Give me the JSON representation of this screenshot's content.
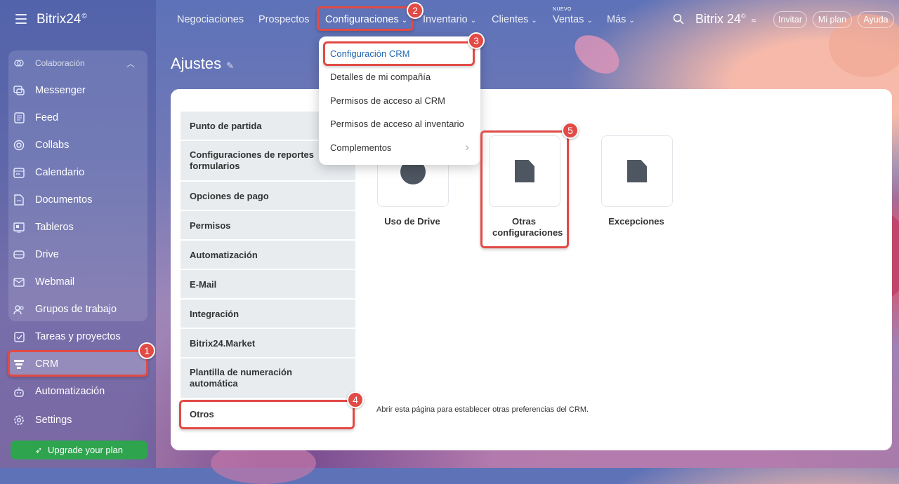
{
  "brand": {
    "name": "Bitrix24",
    "mark": "©"
  },
  "sidebar": {
    "group_label": "Colaboración",
    "items": [
      {
        "label": "Messenger"
      },
      {
        "label": "Feed"
      },
      {
        "label": "Collabs"
      },
      {
        "label": "Calendario"
      },
      {
        "label": "Documentos"
      },
      {
        "label": "Tableros"
      },
      {
        "label": "Drive"
      },
      {
        "label": "Webmail"
      },
      {
        "label": "Grupos de trabajo"
      }
    ],
    "extra": [
      {
        "label": "Tareas y proyectos"
      },
      {
        "label": "CRM"
      },
      {
        "label": "Automatización"
      },
      {
        "label": "Settings"
      }
    ],
    "upgrade_label": "Upgrade your plan"
  },
  "topnav": {
    "items": [
      {
        "label": "Negociaciones"
      },
      {
        "label": "Prospectos"
      },
      {
        "label": "Configuraciones",
        "chev": "⌄"
      },
      {
        "label": "Inventario",
        "chev": "⌄"
      },
      {
        "label": "Clientes",
        "chev": "⌄"
      },
      {
        "label": "Ventas",
        "chev": "⌄"
      },
      {
        "label": "Más",
        "chev": "⌄"
      }
    ],
    "new_tag": "NUEVO",
    "right_brand": "Bitrix 24",
    "buttons": {
      "invite": "Invitar",
      "plan": "Mi plan",
      "help": "Ayuda"
    }
  },
  "page": {
    "title": "Ajustes"
  },
  "settings_menu": [
    {
      "label": "Punto de partida"
    },
    {
      "label": "Configuraciones de reportes formularios"
    },
    {
      "label": "Opciones de pago"
    },
    {
      "label": "Permisos"
    },
    {
      "label": "Automatización"
    },
    {
      "label": "E-Mail"
    },
    {
      "label": "Integración"
    },
    {
      "label": "Bitrix24.Market"
    },
    {
      "label": "Plantilla de numeración automática"
    },
    {
      "label": "Otros"
    }
  ],
  "tiles": [
    {
      "label": "Uso de Drive"
    },
    {
      "label": "Otras configuraciones"
    },
    {
      "label": "Excepciones"
    }
  ],
  "info_text": "Abrir esta página para establecer otras preferencias del CRM.",
  "dropdown": [
    {
      "label": "Configuración CRM"
    },
    {
      "label": "Detalles de mi compañía"
    },
    {
      "label": "Permisos de acceso al CRM"
    },
    {
      "label": "Permisos de acceso al inventario"
    },
    {
      "label": "Complementos",
      "arrow": "›"
    }
  ],
  "badges": [
    "1",
    "2",
    "3",
    "4",
    "5"
  ],
  "colors": {
    "accent": "#2067b0",
    "highlight": "#e24a45",
    "upgrade": "#2fa44f"
  }
}
